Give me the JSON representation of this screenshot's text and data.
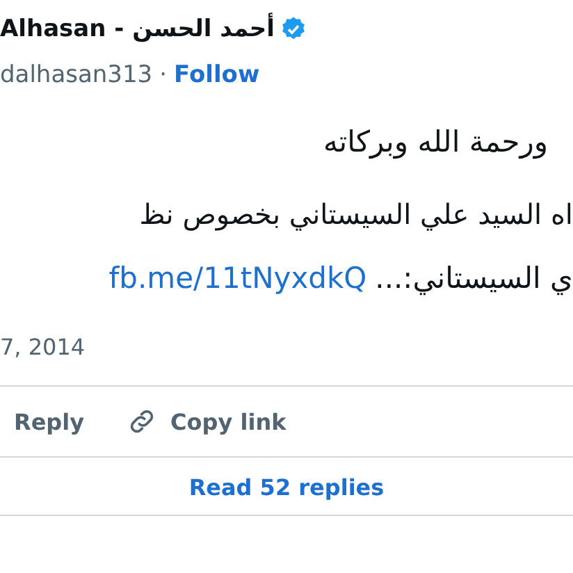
{
  "author": {
    "name": "Alhasan - أحمد الحسن",
    "verified": true,
    "handle": "dalhasan313",
    "separator": "·",
    "follow": "Follow"
  },
  "body": {
    "line_1": "ورحمة الله وبركاته",
    "line_2": "اه السيد علي السيستاني بخصوص نظ",
    "line_3_text": "ي السيستاني:...",
    "link": "fb.me/11tNyxdkQ"
  },
  "date": "7, 2014",
  "actions": {
    "reply": "Reply",
    "copy_link": "Copy link"
  },
  "read_replies": "Read 52 replies"
}
